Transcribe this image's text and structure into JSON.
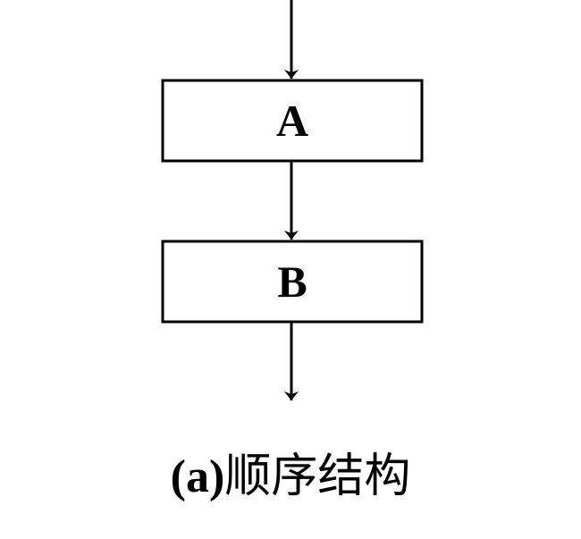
{
  "diagram": {
    "type": "flowchart",
    "colors": {
      "stroke": "#000000",
      "background": "#ffffff"
    },
    "nodes": [
      {
        "id": "A",
        "label": "A"
      },
      {
        "id": "B",
        "label": "B"
      }
    ],
    "edges": [
      {
        "from": null,
        "to": "A"
      },
      {
        "from": "A",
        "to": "B"
      },
      {
        "from": "B",
        "to": null
      }
    ]
  },
  "caption": {
    "prefix": "(a)",
    "title": "顺序结构"
  }
}
